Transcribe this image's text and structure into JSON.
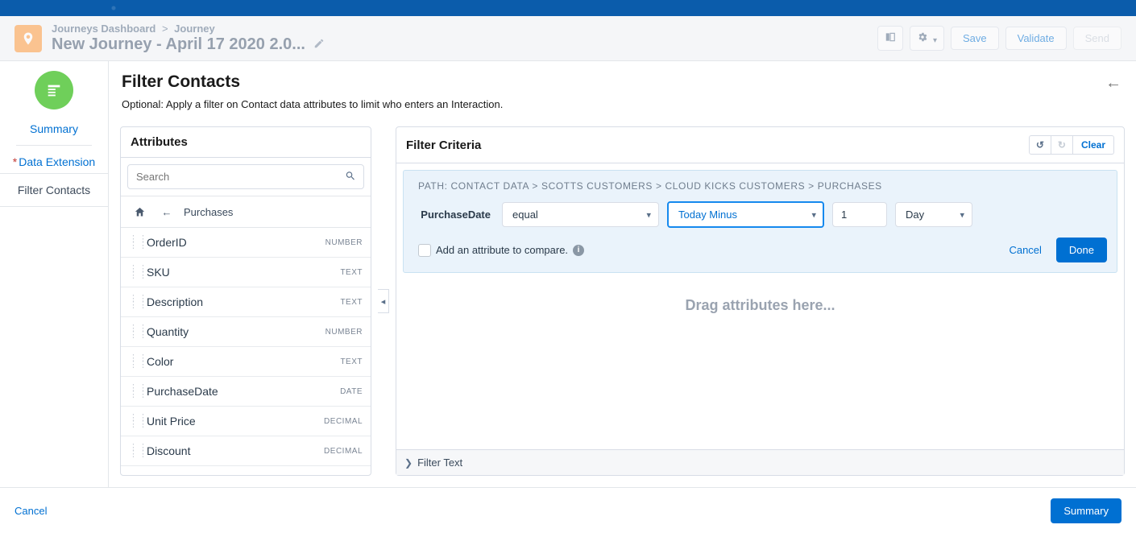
{
  "header": {
    "breadcrumb_root": "Journeys Dashboard",
    "breadcrumb_sep": ">",
    "breadcrumb_leaf": "Journey",
    "title": "New Journey - April 17 2020 2.0...",
    "save_label": "Save",
    "validate_label": "Validate",
    "send_label": "Send"
  },
  "left_rail": {
    "summary_label": "Summary",
    "data_ext_label": "Data Extension",
    "required_marker": "*",
    "current_label": "Filter Contacts"
  },
  "page": {
    "title": "Filter Contacts",
    "subtitle": "Optional: Apply a filter on Contact data attributes to limit who enters an Interaction."
  },
  "attributes": {
    "panel_title": "Attributes",
    "search_placeholder": "Search",
    "current_path": "Purchases",
    "items": [
      {
        "label": "OrderID",
        "type": "NUMBER"
      },
      {
        "label": "SKU",
        "type": "TEXT"
      },
      {
        "label": "Description",
        "type": "TEXT"
      },
      {
        "label": "Quantity",
        "type": "NUMBER"
      },
      {
        "label": "Color",
        "type": "TEXT"
      },
      {
        "label": "PurchaseDate",
        "type": "DATE"
      },
      {
        "label": "Unit Price",
        "type": "DECIMAL"
      },
      {
        "label": "Discount",
        "type": "DECIMAL"
      }
    ]
  },
  "criteria": {
    "panel_title": "Filter Criteria",
    "clear_label": "Clear",
    "path_prefix": "PATH:",
    "path": "CONTACT DATA > SCOTTS CUSTOMERS > CLOUD KICKS CUSTOMERS > PURCHASES",
    "attr_label": "PurchaseDate",
    "operator_value": "equal",
    "relative_value": "Today Minus",
    "number_value": "1",
    "unit_value": "Day",
    "compare_text": "Add an attribute to compare.",
    "cancel_label": "Cancel",
    "done_label": "Done",
    "drop_text": "Drag attributes here...",
    "filter_text_label": "Filter Text"
  },
  "footer": {
    "cancel_label": "Cancel",
    "summary_label": "Summary"
  }
}
